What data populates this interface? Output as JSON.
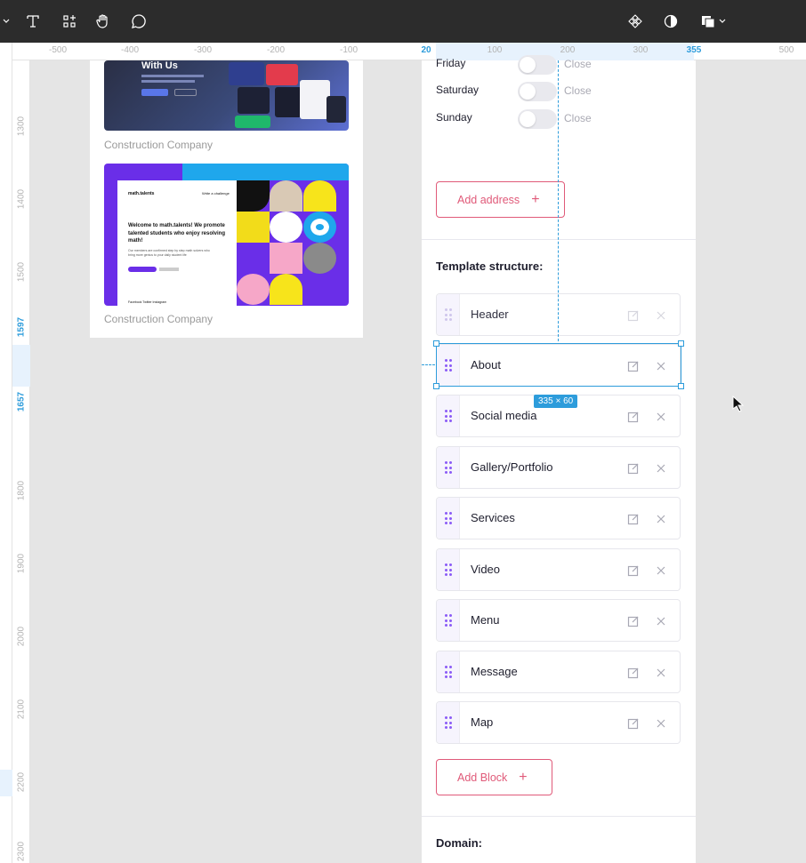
{
  "toolbar": {
    "left_tools": [
      "chevron-down",
      "text-tool",
      "components-tool",
      "hand-tool",
      "comment-tool"
    ],
    "right_tools": [
      "component-icon",
      "contrast-icon",
      "layers-icon"
    ]
  },
  "rulers": {
    "top_labels": [
      "-500",
      "-400",
      "-300",
      "-200",
      "-100",
      "20",
      "100",
      "200",
      "300",
      "355",
      "500"
    ],
    "top_highlighted": [
      "20",
      "355"
    ],
    "left_labels": [
      "1300",
      "1400",
      "1500",
      "1597",
      "1657",
      "1800",
      "1900",
      "2000",
      "2100",
      "2200",
      "2300"
    ],
    "left_highlighted": [
      "1597",
      "1657"
    ]
  },
  "cards": [
    {
      "caption": "Construction Company",
      "heading": "With Us"
    },
    {
      "caption": "Construction Company",
      "brand": "math.talents",
      "challenge": "Write a challenge",
      "headline": "Welcome to math.talents! We promote talented students who enjoy resolving math!",
      "paragraph": "Our members are confirmed step by step math solvers who bring more genius to your daily student life",
      "footer": "Facebook   Twitter   Instagram"
    }
  ],
  "opening_hours": [
    {
      "day": "Friday",
      "status": "Close",
      "enabled": false
    },
    {
      "day": "Saturday",
      "status": "Close",
      "enabled": false
    },
    {
      "day": "Sunday",
      "status": "Close",
      "enabled": false
    }
  ],
  "add_address_label": "Add address",
  "template_structure": {
    "title": "Template structure:",
    "blocks": [
      {
        "name": "Header"
      },
      {
        "name": "About"
      },
      {
        "name": "Social media"
      },
      {
        "name": "Gallery/Portfolio"
      },
      {
        "name": "Services"
      },
      {
        "name": "Video"
      },
      {
        "name": "Menu"
      },
      {
        "name": "Message"
      },
      {
        "name": "Map"
      }
    ],
    "add_block_label": "Add Block"
  },
  "domain": {
    "title": "Domain:"
  },
  "selection": {
    "size_label": "335 × 60"
  },
  "colors": {
    "toolbar_bg": "#2c2c2c",
    "accent": "#e05a79",
    "selection": "#2d9cdb",
    "handle_dots": "#8b5cf6"
  }
}
